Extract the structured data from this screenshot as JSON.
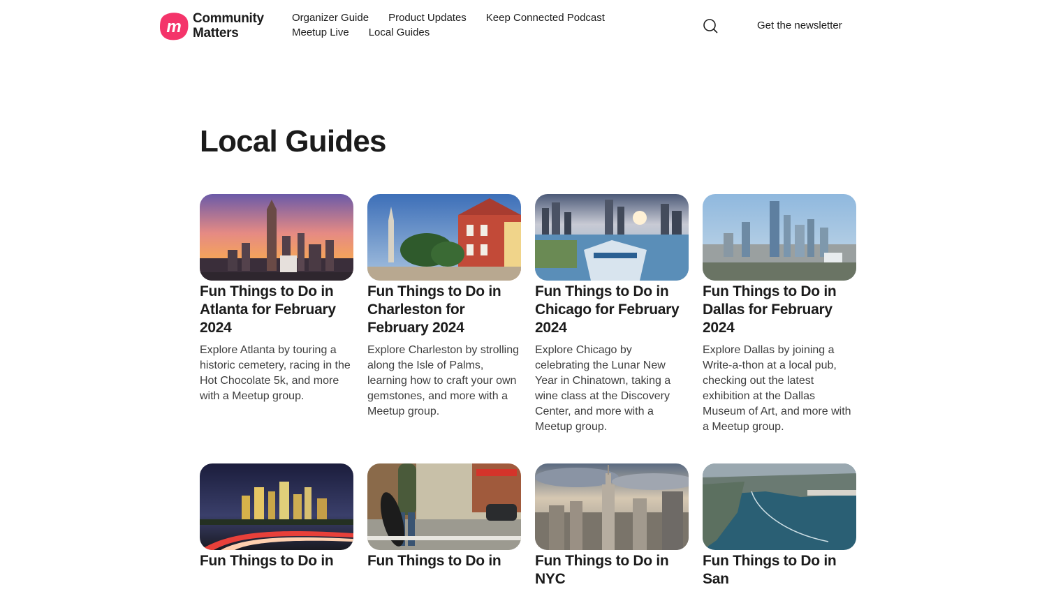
{
  "brand": {
    "line1": "Community",
    "line2": "Matters",
    "mark_letter": "m",
    "mark_color": "#f4346a"
  },
  "nav": {
    "items": [
      {
        "label": "Organizer Guide"
      },
      {
        "label": "Product Updates"
      },
      {
        "label": "Keep Connected Podcast"
      },
      {
        "label": "Meetup Live"
      },
      {
        "label": "Local Guides"
      }
    ]
  },
  "search": {
    "icon": "search-icon"
  },
  "newsletter": {
    "label": "Get the newsletter"
  },
  "page": {
    "title": "Local Guides"
  },
  "cards": [
    {
      "title": "Fun Things to Do in Atlanta for February 2024",
      "description": "Explore Atlanta by touring a historic cemetery, racing in the Hot Chocolate 5k, and more with a Meetup group.",
      "image": "atlanta-skyline-sunset"
    },
    {
      "title": "Fun Things to Do in Charleston for February 2024",
      "description": "Explore Charleston by strolling along the Isle of Palms, learning how to craft your own gemstones, and more with a Meetup group.",
      "image": "charleston-rainbow-row"
    },
    {
      "title": "Fun Things to Do in Chicago for February 2024",
      "description": "Explore Chicago by celebrating the Lunar New Year in Chinatown, taking a wine class at the Discovery Center, and more with a Meetup group.",
      "image": "chicago-navy-pier"
    },
    {
      "title": "Fun Things to Do in Dallas for February 2024",
      "description": "Explore Dallas by joining a Write-a-thon at a local pub, checking out the latest exhibition at the Dallas Museum of Art, and more with a Meetup group.",
      "image": "dallas-aerial"
    },
    {
      "title": "Fun Things to Do in",
      "description": "",
      "image": "houston-night-highway"
    },
    {
      "title": "Fun Things to Do in",
      "description": "",
      "image": "nashville-street-guitar"
    },
    {
      "title": "Fun Things to Do in NYC",
      "description": "",
      "image": "nyc-empire-state"
    },
    {
      "title": "Fun Things to Do in San",
      "description": "",
      "image": "san-francisco-bay"
    }
  ]
}
